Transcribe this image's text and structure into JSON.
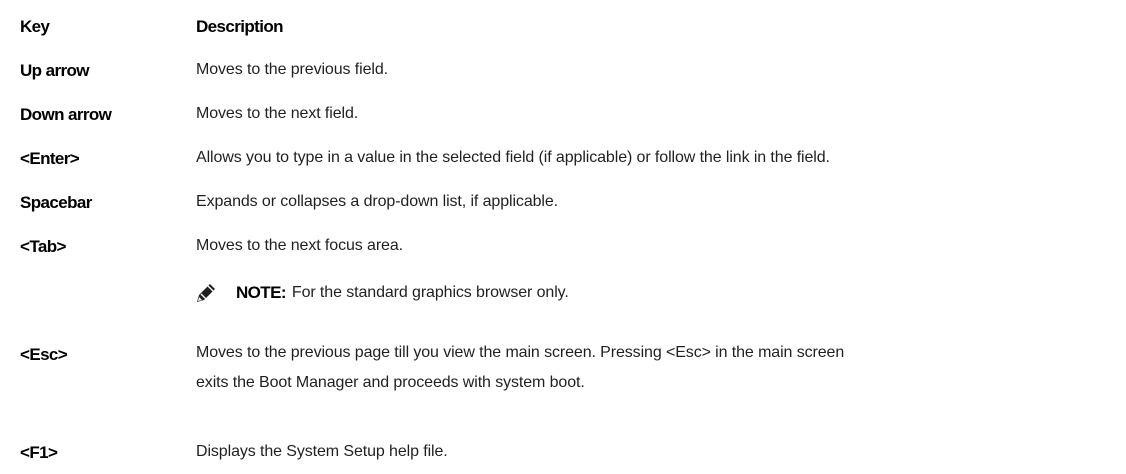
{
  "table": {
    "header": {
      "key": "Key",
      "description": "Description"
    },
    "rows": [
      {
        "key": "Up arrow",
        "description": "Moves to the previous field."
      },
      {
        "key": "Down arrow",
        "description": "Moves to the next field."
      },
      {
        "key": "<Enter>",
        "description": "Allows you to type in a value in the selected field (if applicable) or follow the link in the field."
      },
      {
        "key": "Spacebar",
        "description": "Expands or collapses a drop-down list, if applicable."
      },
      {
        "key": "<Tab>",
        "description": "Moves to the next focus area."
      },
      {
        "key": "<Esc>",
        "description_line1": "Moves to the previous page till you view the main screen. Pressing <Esc> in the main screen",
        "description_line2": "exits the Boot Manager and proceeds with system boot."
      },
      {
        "key": "<F1>",
        "description": "Displays the System Setup help file."
      }
    ],
    "note": {
      "icon": "pencil-note-icon",
      "label": "NOTE:",
      "text": "For the standard graphics browser only."
    }
  }
}
